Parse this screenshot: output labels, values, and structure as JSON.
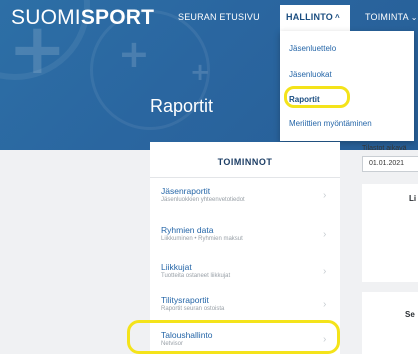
{
  "header": {
    "brand_light": "SUOMI",
    "brand_bold": "SPORT",
    "page_title": "Raportit"
  },
  "nav": {
    "items": [
      {
        "label": "SEURAN ETUSIVU"
      },
      {
        "label": "HALLINTO"
      },
      {
        "label": "TOIMINTA"
      }
    ]
  },
  "dropdown": {
    "items": [
      {
        "label": "Jäsenluettelo"
      },
      {
        "label": "Jäsenluokat"
      },
      {
        "label": "Raportit",
        "active": true
      },
      {
        "label": "Meriittien myöntäminen"
      }
    ]
  },
  "menu": {
    "title": "TOIMINNOT",
    "items": [
      {
        "title": "Jäsenraportit",
        "subtitle": "Jäsenluokkien yhteenvetotiedot"
      },
      {
        "title": "Ryhmien data",
        "subtitle": "Liikkuminen • Ryhmien maksut"
      },
      {
        "title": "Liikkujat",
        "subtitle": "Tuotteita ostaneet liikkujat"
      },
      {
        "title": "Tilitysraportit",
        "subtitle": "Raportit seuran ostoista"
      },
      {
        "title": "Taloushallinto",
        "subtitle": "Netvisor",
        "highlighted": true
      }
    ]
  },
  "stats": {
    "label": "Tilastot aikavä",
    "date_value": "01.01.2021"
  },
  "right_cards": {
    "card1_title": "Li",
    "card2_title": "Se"
  },
  "colors": {
    "header_blue": "#2a66a0",
    "link_blue": "#2566a8",
    "highlight_yellow": "#f4e31a"
  }
}
